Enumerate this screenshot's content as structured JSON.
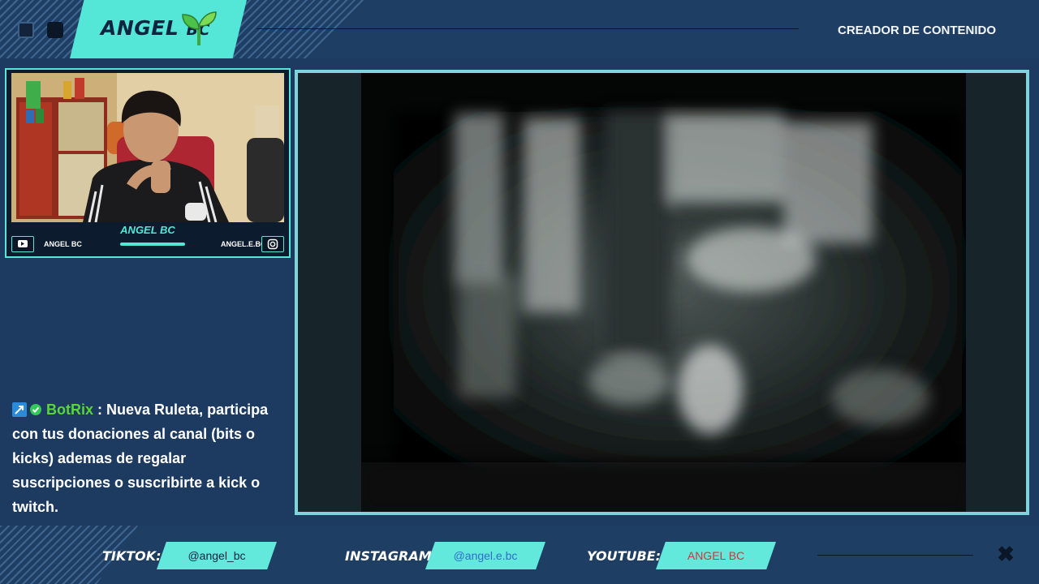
{
  "header": {
    "logo_main": "ANGEL",
    "logo_suffix": "BC",
    "tagline": "CREADOR DE CONTENIDO"
  },
  "webcam": {
    "name": "ANGEL BC",
    "youtube_handle": "ANGEL BC",
    "instagram_handle": "ANGEL.E.BC"
  },
  "chat": {
    "username": "BotRix",
    "separator": ":",
    "message": "Nueva Ruleta, participa con tus donaciones al canal (bits o kicks) ademas de regalar suscripciones o suscribirte a kick o twitch."
  },
  "footer": {
    "tiktok_label": "TIKTOK:",
    "tiktok_handle": "@angel_bc",
    "instagram_label": "INSTAGRAM:",
    "instagram_handle": "@angel.e.bc",
    "youtube_label": "YOUTUBE:",
    "youtube_handle": "ANGEL BC"
  },
  "colors": {
    "accent": "#54e6d6",
    "background": "#1d3b60",
    "chat_username": "#58d63a",
    "youtube_handle_text": "#d3343c",
    "instagram_handle_text": "#2f6fc9",
    "tiktok_handle_text": "#0f2440"
  },
  "icons": {
    "logo": "sprout-icon",
    "webcam_left": "youtube-icon",
    "webcam_right": "instagram-icon",
    "chat_badge_1": "broadcaster-badge-icon",
    "chat_badge_2": "verified-badge-icon",
    "footer_close": "close-icon"
  }
}
